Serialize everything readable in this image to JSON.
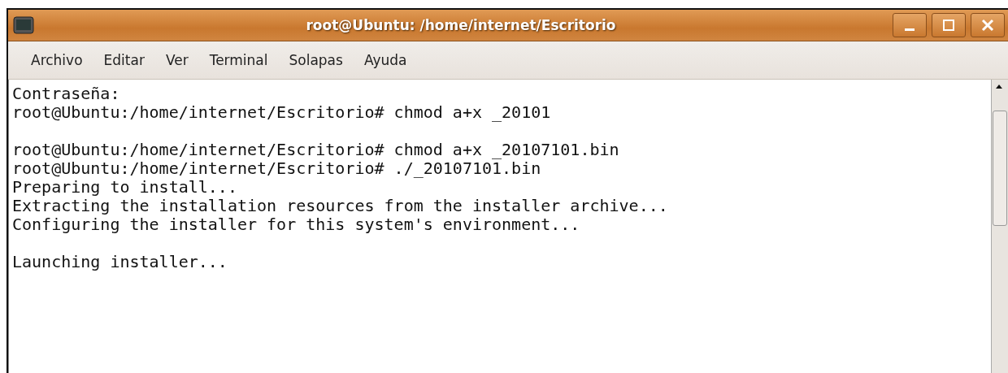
{
  "window": {
    "title": "root@Ubuntu: /home/internet/Escritorio"
  },
  "menu": [
    "Archivo",
    "Editar",
    "Ver",
    "Terminal",
    "Solapas",
    "Ayuda"
  ],
  "terminal": {
    "blocks": [
      [
        "Contraseña:",
        "root@Ubuntu:/home/internet/Escritorio# chmod a+x _20101"
      ],
      [
        "root@Ubuntu:/home/internet/Escritorio# chmod a+x _20107101.bin",
        "root@Ubuntu:/home/internet/Escritorio# ./_20107101.bin",
        "Preparing to install...",
        "Extracting the installation resources from the installer archive...",
        "Configuring the installer for this system's environment..."
      ],
      [
        "Launching installer..."
      ]
    ]
  }
}
